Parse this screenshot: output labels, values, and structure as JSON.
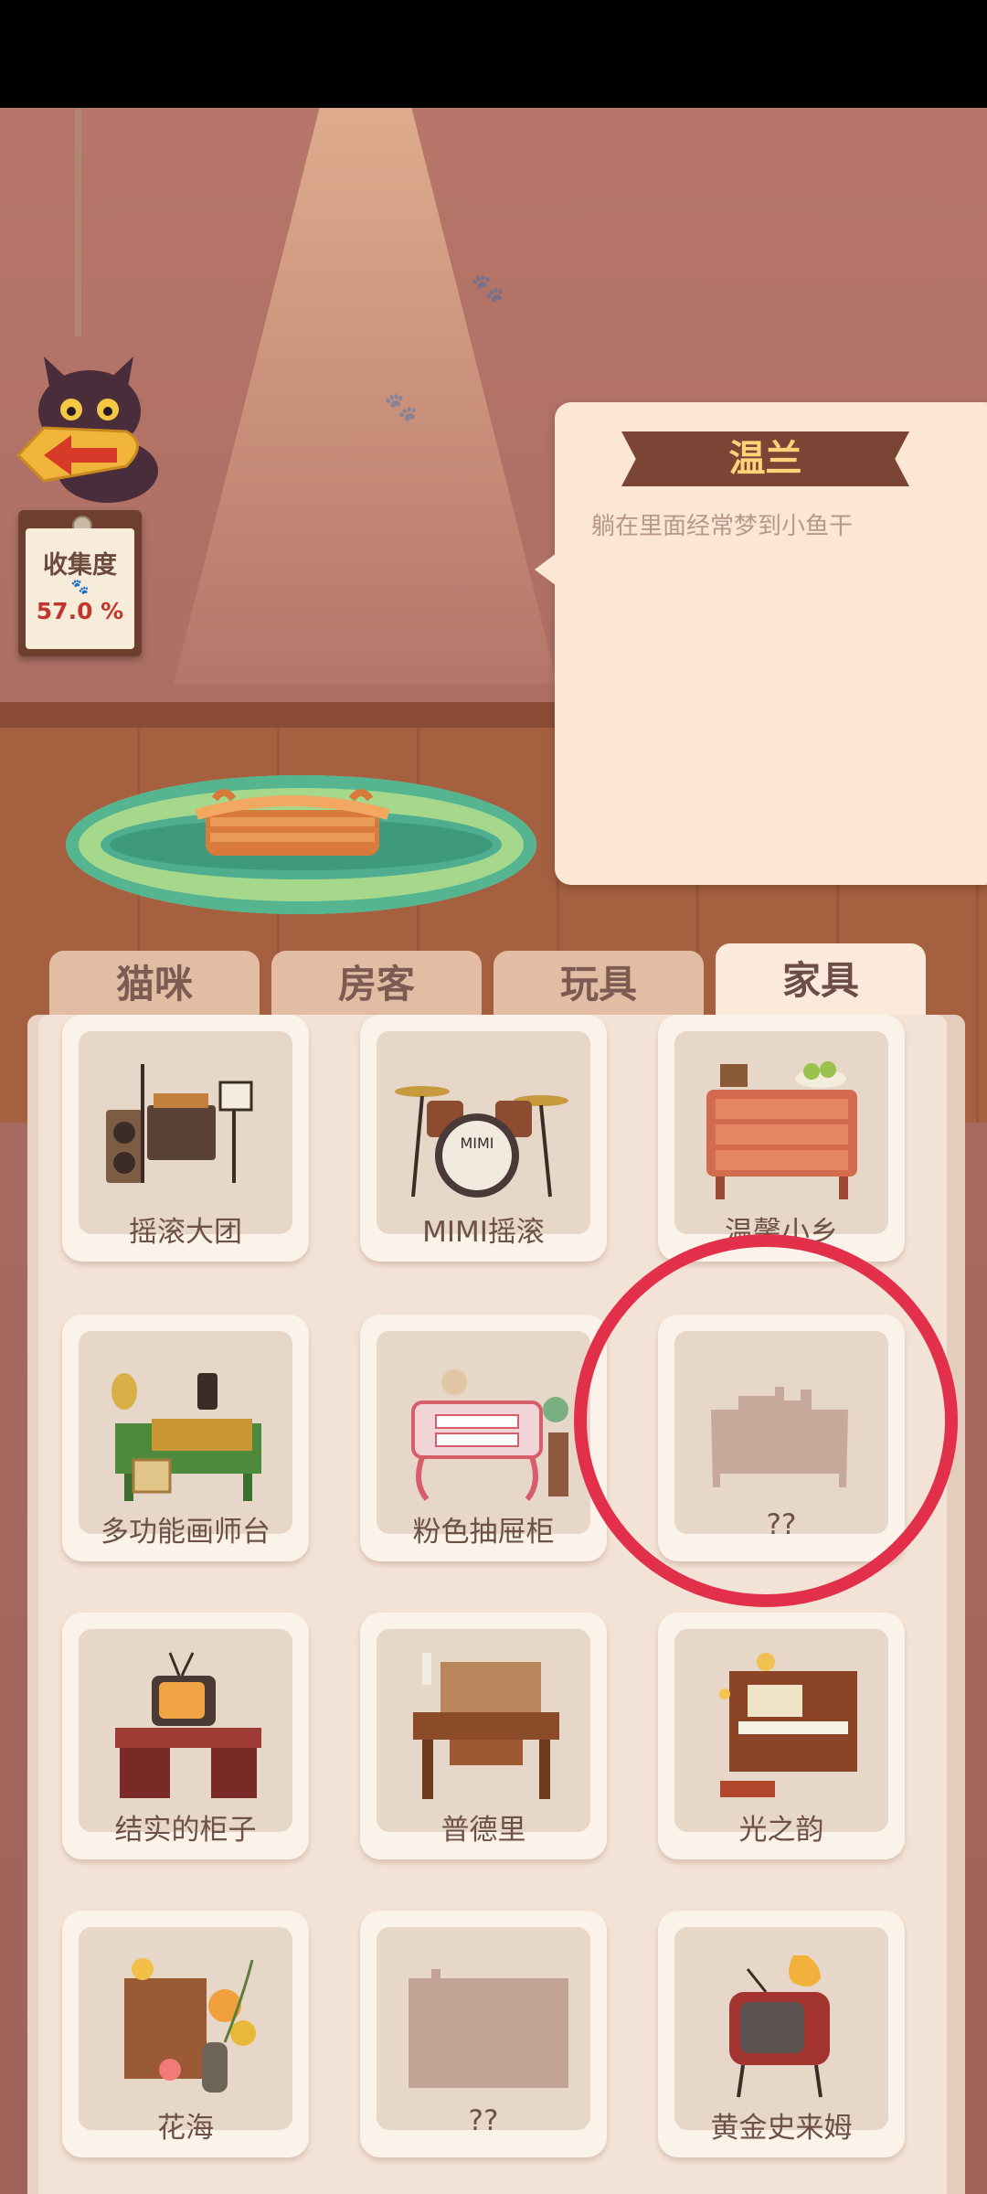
{
  "back_button": {
    "icon": "arrow-left-icon"
  },
  "collection": {
    "title": "收集度",
    "value": "57.0 %"
  },
  "selected_item": {
    "name": "温兰",
    "description": "躺在里面经常梦到小鱼干"
  },
  "tabs": [
    {
      "label": "猫咪",
      "active": false
    },
    {
      "label": "房客",
      "active": false
    },
    {
      "label": "玩具",
      "active": false
    },
    {
      "label": "家具",
      "active": true
    }
  ],
  "items": [
    {
      "name": "摇滚大团",
      "art": "rock-band-icon"
    },
    {
      "name": "MIMI摇滚",
      "art": "drum-kit-icon"
    },
    {
      "name": "温馨小乡",
      "art": "dresser-icon"
    },
    {
      "name": "多功能画师台",
      "art": "art-desk-icon"
    },
    {
      "name": "粉色抽屉柜",
      "art": "pink-vanity-icon"
    },
    {
      "name": "??",
      "art": "locked-silhouette-icon"
    },
    {
      "name": "结实的柜子",
      "art": "tv-desk-icon"
    },
    {
      "name": "普德里",
      "art": "writing-desk-icon"
    },
    {
      "name": "光之韵",
      "art": "organ-icon"
    },
    {
      "name": "花海",
      "art": "flower-shelf-icon"
    },
    {
      "name": "??",
      "art": "locked-silhouette-icon"
    },
    {
      "name": "黄金史来姆",
      "art": "retro-tv-icon"
    }
  ]
}
